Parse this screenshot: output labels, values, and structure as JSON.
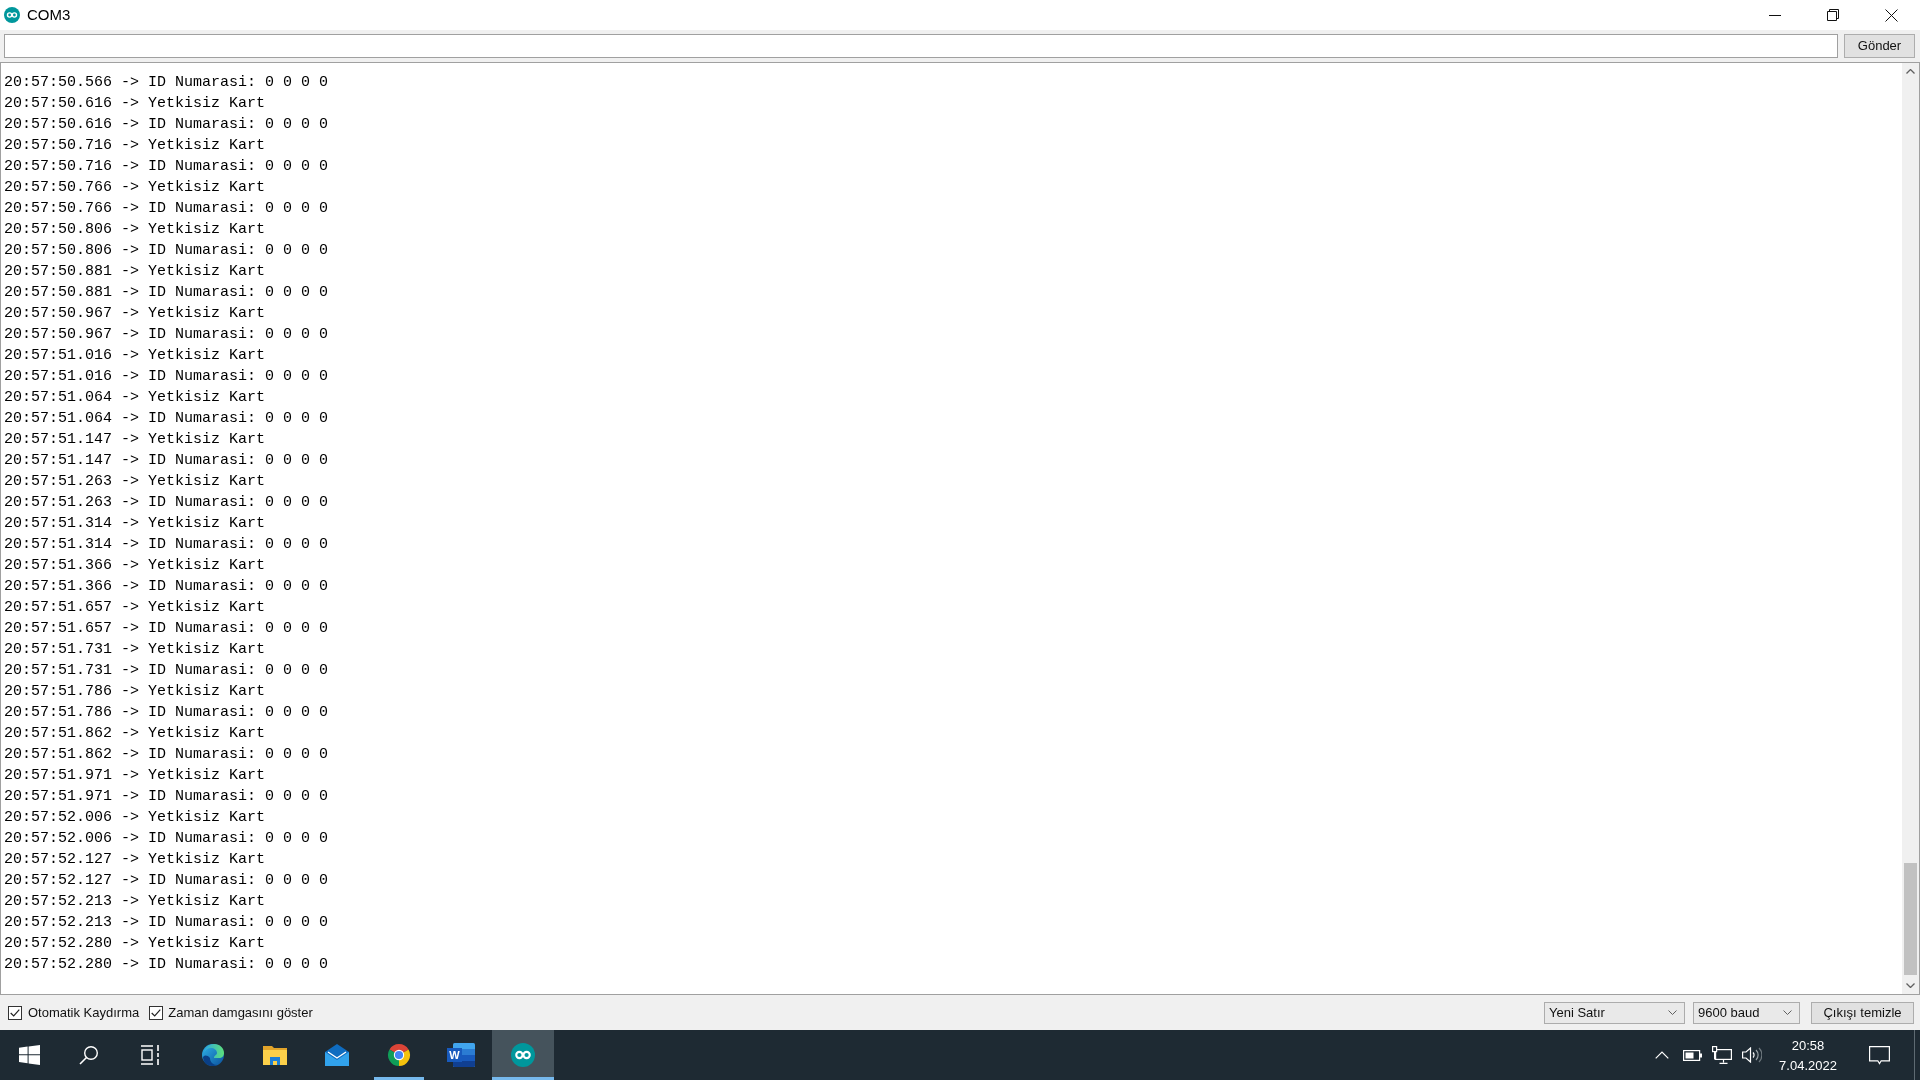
{
  "window": {
    "title": "COM3"
  },
  "send_bar": {
    "send_button": "Gönder"
  },
  "output": {
    "lines": [
      "20:57:50.566 -> ID Numarasi: 0 0 0 0",
      "20:57:50.616 -> Yetkisiz Kart",
      "20:57:50.616 -> ID Numarasi: 0 0 0 0",
      "20:57:50.716 -> Yetkisiz Kart",
      "20:57:50.716 -> ID Numarasi: 0 0 0 0",
      "20:57:50.766 -> Yetkisiz Kart",
      "20:57:50.766 -> ID Numarasi: 0 0 0 0",
      "20:57:50.806 -> Yetkisiz Kart",
      "20:57:50.806 -> ID Numarasi: 0 0 0 0",
      "20:57:50.881 -> Yetkisiz Kart",
      "20:57:50.881 -> ID Numarasi: 0 0 0 0",
      "20:57:50.967 -> Yetkisiz Kart",
      "20:57:50.967 -> ID Numarasi: 0 0 0 0",
      "20:57:51.016 -> Yetkisiz Kart",
      "20:57:51.016 -> ID Numarasi: 0 0 0 0",
      "20:57:51.064 -> Yetkisiz Kart",
      "20:57:51.064 -> ID Numarasi: 0 0 0 0",
      "20:57:51.147 -> Yetkisiz Kart",
      "20:57:51.147 -> ID Numarasi: 0 0 0 0",
      "20:57:51.263 -> Yetkisiz Kart",
      "20:57:51.263 -> ID Numarasi: 0 0 0 0",
      "20:57:51.314 -> Yetkisiz Kart",
      "20:57:51.314 -> ID Numarasi: 0 0 0 0",
      "20:57:51.366 -> Yetkisiz Kart",
      "20:57:51.366 -> ID Numarasi: 0 0 0 0",
      "20:57:51.657 -> Yetkisiz Kart",
      "20:57:51.657 -> ID Numarasi: 0 0 0 0",
      "20:57:51.731 -> Yetkisiz Kart",
      "20:57:51.731 -> ID Numarasi: 0 0 0 0",
      "20:57:51.786 -> Yetkisiz Kart",
      "20:57:51.786 -> ID Numarasi: 0 0 0 0",
      "20:57:51.862 -> Yetkisiz Kart",
      "20:57:51.862 -> ID Numarasi: 0 0 0 0",
      "20:57:51.971 -> Yetkisiz Kart",
      "20:57:51.971 -> ID Numarasi: 0 0 0 0",
      "20:57:52.006 -> Yetkisiz Kart",
      "20:57:52.006 -> ID Numarasi: 0 0 0 0",
      "20:57:52.127 -> Yetkisiz Kart",
      "20:57:52.127 -> ID Numarasi: 0 0 0 0",
      "20:57:52.213 -> Yetkisiz Kart",
      "20:57:52.213 -> ID Numarasi: 0 0 0 0",
      "20:57:52.280 -> Yetkisiz Kart",
      "20:57:52.280 -> ID Numarasi: 0 0 0 0"
    ]
  },
  "bottom_bar": {
    "options": [
      {
        "label": "Otomatik Kaydırma",
        "checked": true
      },
      {
        "label": "Zaman damgasını göster",
        "checked": true
      }
    ],
    "line_ending": {
      "value": "Yeni Satır"
    },
    "baud_rate": {
      "value": "9600 baud"
    },
    "clear_button": "Çıkışı temizle"
  },
  "taskbar": {
    "apps": [
      {
        "kind": "swirl",
        "running": false,
        "selected": false
      },
      {
        "kind": "folder",
        "running": false,
        "selected": false
      },
      {
        "kind": "envelope",
        "running": false,
        "selected": false
      },
      {
        "kind": "tricolor",
        "running": true,
        "selected": false
      },
      {
        "kind": "document",
        "letter": "W",
        "running": false,
        "selected": false
      },
      {
        "kind": "infinity",
        "running": true,
        "selected": true
      }
    ],
    "clock": {
      "time": "20:58",
      "date": "7.04.2022"
    }
  }
}
